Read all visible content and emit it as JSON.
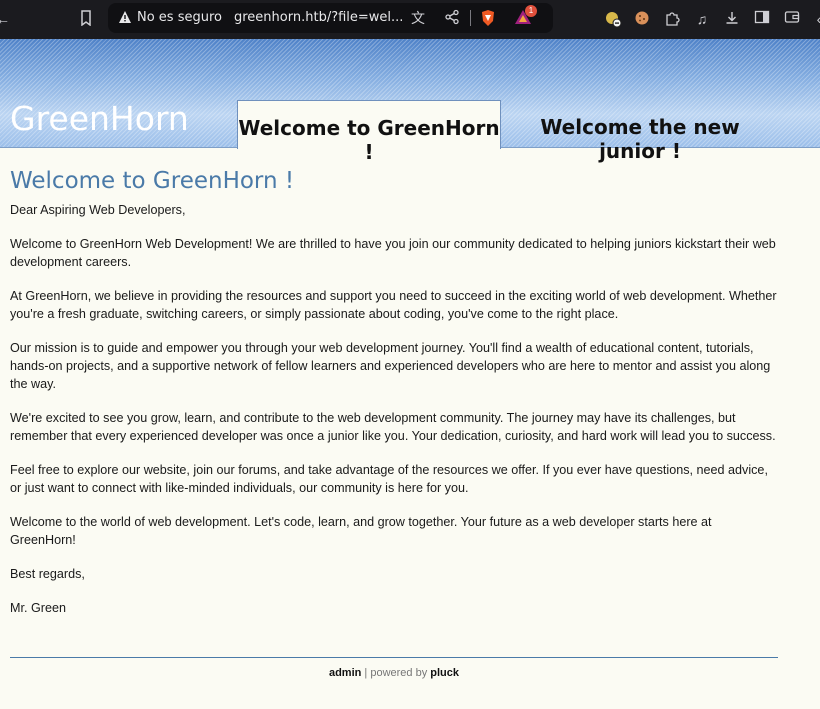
{
  "browser": {
    "security_label": "No es seguro",
    "url": "greenhorn.htb/?file=wel...",
    "notification_count": "1",
    "icons": [
      "back-icon",
      "bookmark-icon",
      "warning-icon",
      "translate-icon",
      "share-icon",
      "brave-shield-icon",
      "brave-rewards-icon",
      "extension-icon",
      "puzzle-icon",
      "media-icon",
      "download-icon",
      "sidebar-icon",
      "wallet-icon",
      "menu-icon"
    ]
  },
  "header": {
    "site_title": "GreenHorn",
    "tabs": [
      {
        "label": "Welcome to GreenHorn !",
        "active": true
      },
      {
        "label": "Welcome the new junior !",
        "active": false
      }
    ]
  },
  "main": {
    "title": "Welcome to GreenHorn !",
    "paragraphs": [
      "Dear Aspiring Web Developers,",
      "Welcome to GreenHorn Web Development! We are thrilled to have you join our community dedicated to helping juniors kickstart their web development careers.",
      "At GreenHorn, we believe in providing the resources and support you need to succeed in the exciting world of web development. Whether you're a fresh graduate, switching careers, or simply passionate about coding, you've come to the right place.",
      "Our mission is to guide and empower you through your web development journey. You'll find a wealth of educational content, tutorials, hands-on projects, and a supportive network of fellow learners and experienced developers who are here to mentor and assist you along the way.",
      "We're excited to see you grow, learn, and contribute to the web development community. The journey may have its challenges, but remember that every experienced developer was once a junior like you. Your dedication, curiosity, and hard work will lead you to success.",
      "Feel free to explore our website, join our forums, and take advantage of the resources we offer. If you ever have questions, need advice, or just want to connect with like-minded individuals, our community is here for you.",
      "Welcome to the world of web development. Let's code, learn, and grow together. Your future as a web developer starts here at GreenHorn!",
      "Best regards,",
      "Mr. Green"
    ]
  },
  "footer": {
    "admin_link": "admin",
    "separator": " | powered by ",
    "pluck_link": "pluck"
  }
}
